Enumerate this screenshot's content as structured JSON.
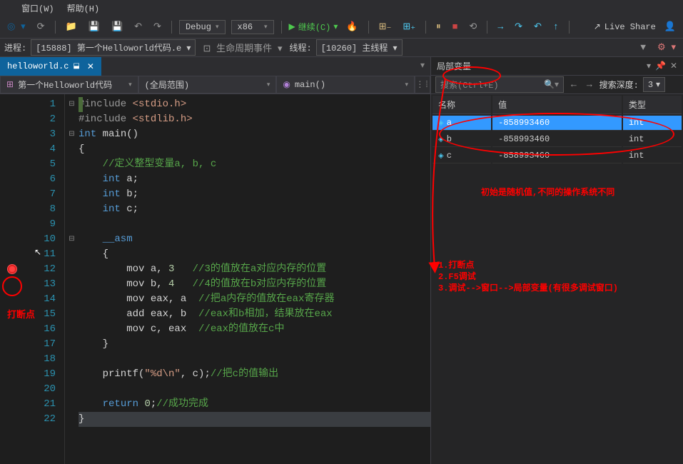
{
  "menu": {
    "window": "窗口(W)",
    "help": "帮助(H)"
  },
  "toolbar": {
    "debug_label": "Debug",
    "arch_label": "x86",
    "continue_label": "继续(C)",
    "liveshare_label": "Live Share"
  },
  "breadcrumb": {
    "process_label": "进程:",
    "process_value": "[15888] 第一个Helloworld代码.e",
    "lifecycle_label": "生命周期事件",
    "thread_label": "线程:",
    "thread_value": "[10260] 主线程"
  },
  "tab": {
    "filename": "helloworld.c"
  },
  "nav": {
    "project": "第一个Helloworld代码",
    "scope": "(全局范围)",
    "func": "main()"
  },
  "code": {
    "l1a": "#include ",
    "l1b": "<stdio.h>",
    "l2a": "#include ",
    "l2b": "<stdlib.h>",
    "l3a": "int",
    "l3b": " main()",
    "l4": "{",
    "l5": "    //定义整型变量a, b, c",
    "l6a": "    ",
    "l6b": "int",
    "l6c": " a;",
    "l7a": "    ",
    "l7b": "int",
    "l7c": " b;",
    "l8a": "    ",
    "l8b": "int",
    "l8c": " c;",
    "l10": "    __asm",
    "l11": "    {",
    "l12a": "        mov a, ",
    "l12n": "3",
    "l12c": "   //3的值放在a对应内存的位置",
    "l13a": "        mov b, ",
    "l13n": "4",
    "l13c": "   //4的值放在b对应内存的位置",
    "l14a": "        mov eax, a  ",
    "l14c": "//把a内存的值放在eax寄存器",
    "l15a": "        add eax, b  ",
    "l15c": "//eax和b相加，结果放在eax",
    "l16a": "        mov c, eax  ",
    "l16c": "//eax的值放在c中",
    "l17": "    }",
    "l19a": "    printf(",
    "l19s": "\"%d\\n\"",
    "l19b": ", c);",
    "l19c": "//把c的值输出",
    "l21a": "    ",
    "l21b": "return",
    "l21c": " ",
    "l21n": "0",
    "l21d": ";",
    "l21e": "//成功完成",
    "l22": "}"
  },
  "locals": {
    "title": "局部变量",
    "search_ph": "搜索(Ctrl+E)",
    "depth_label": "搜索深度:",
    "depth_value": "3",
    "cols": {
      "name": "名称",
      "value": "值",
      "type": "类型"
    },
    "rows": [
      {
        "name": "a",
        "value": "-858993460",
        "type": "int"
      },
      {
        "name": "b",
        "value": "-858993460",
        "type": "int"
      },
      {
        "name": "c",
        "value": "-858993460",
        "type": "int"
      }
    ]
  },
  "annotations": {
    "bp_label": "打断点",
    "random_note": "初始是随机值,不同的操作系统不同",
    "step1": "1.打断点",
    "step2": "2.F5调试",
    "step3": "3.调试-->窗口-->局部变量(有很多调试窗口)"
  }
}
